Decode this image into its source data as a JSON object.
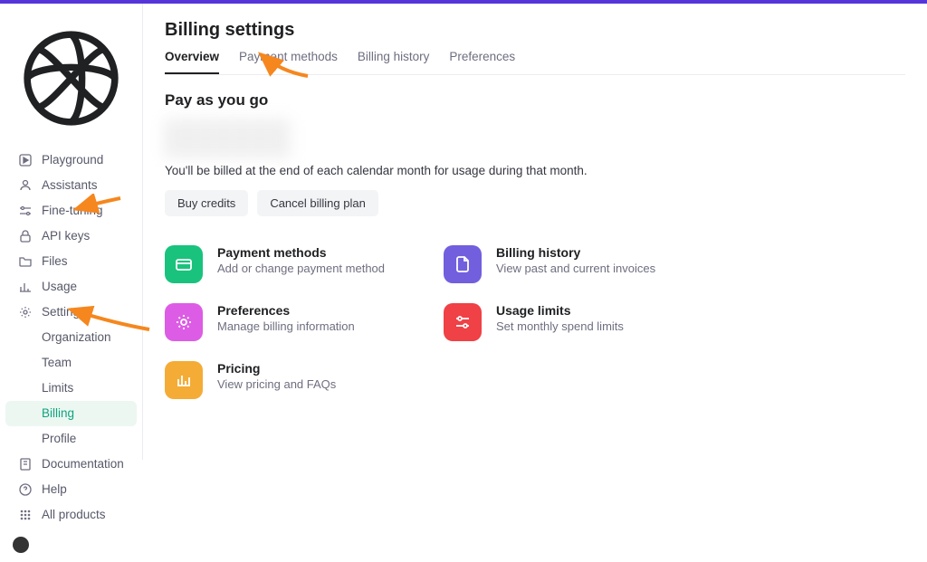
{
  "sidebar": {
    "primary": [
      {
        "label": "Playground",
        "name": "playground"
      },
      {
        "label": "Assistants",
        "name": "assistants"
      },
      {
        "label": "Fine-tuning",
        "name": "fine-tuning"
      },
      {
        "label": "API keys",
        "name": "api-keys"
      },
      {
        "label": "Files",
        "name": "files"
      },
      {
        "label": "Usage",
        "name": "usage"
      },
      {
        "label": "Settings",
        "name": "settings"
      }
    ],
    "settings_children": [
      {
        "label": "Organization",
        "name": "organization"
      },
      {
        "label": "Team",
        "name": "team"
      },
      {
        "label": "Limits",
        "name": "limits"
      },
      {
        "label": "Billing",
        "name": "billing",
        "active": true
      },
      {
        "label": "Profile",
        "name": "profile"
      }
    ],
    "secondary": [
      {
        "label": "Documentation",
        "name": "documentation"
      },
      {
        "label": "Help",
        "name": "help"
      },
      {
        "label": "All products",
        "name": "all-products"
      }
    ]
  },
  "page": {
    "title": "Billing settings",
    "tabs": [
      {
        "label": "Overview",
        "active": true
      },
      {
        "label": "Payment methods"
      },
      {
        "label": "Billing history"
      },
      {
        "label": "Preferences"
      }
    ],
    "section_title": "Pay as you go",
    "billing_note": "You'll be billed at the end of each calendar month for usage during that month.",
    "buttons": {
      "buy_credits": "Buy credits",
      "cancel_plan": "Cancel billing plan"
    },
    "cards": [
      {
        "title": "Payment methods",
        "desc": "Add or change payment method",
        "color": "green",
        "icon": "card-icon"
      },
      {
        "title": "Billing history",
        "desc": "View past and current invoices",
        "color": "purple",
        "icon": "file-icon"
      },
      {
        "title": "Preferences",
        "desc": "Manage billing information",
        "color": "magenta",
        "icon": "gear-icon"
      },
      {
        "title": "Usage limits",
        "desc": "Set monthly spend limits",
        "color": "red",
        "icon": "sliders-icon"
      },
      {
        "title": "Pricing",
        "desc": "View pricing and FAQs",
        "color": "orange",
        "icon": "chart-icon"
      }
    ]
  },
  "annotation": {
    "arrow_color": "#f5871e"
  }
}
